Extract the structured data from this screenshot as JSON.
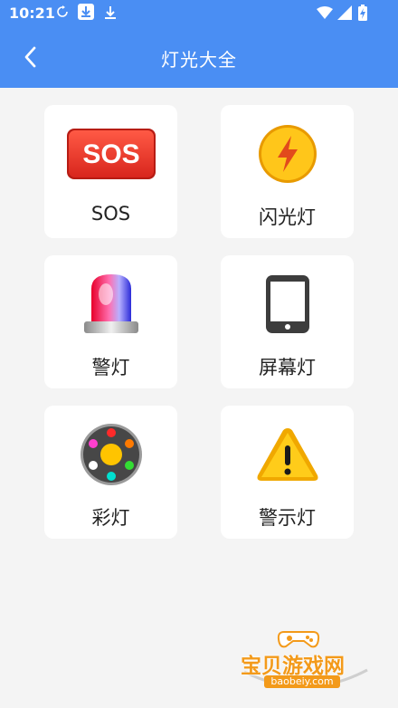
{
  "status_bar": {
    "time": "10:21"
  },
  "header": {
    "title": "灯光大全"
  },
  "cards": [
    {
      "label": "SOS",
      "icon": "sos-badge-icon",
      "badge_text": "SOS"
    },
    {
      "label": "闪光灯",
      "icon": "lightning-icon"
    },
    {
      "label": "警灯",
      "icon": "police-siren-icon"
    },
    {
      "label": "屏幕灯",
      "icon": "phone-screen-icon"
    },
    {
      "label": "彩灯",
      "icon": "color-lights-icon"
    },
    {
      "label": "警示灯",
      "icon": "warning-triangle-icon"
    }
  ],
  "watermark": {
    "name": "宝贝游戏网",
    "url": "baobeiy.com"
  },
  "colors": {
    "header": "#4a8ef3",
    "background": "#f4f4f4",
    "sos_red": "#e8332a",
    "amber": "#f7b500"
  }
}
